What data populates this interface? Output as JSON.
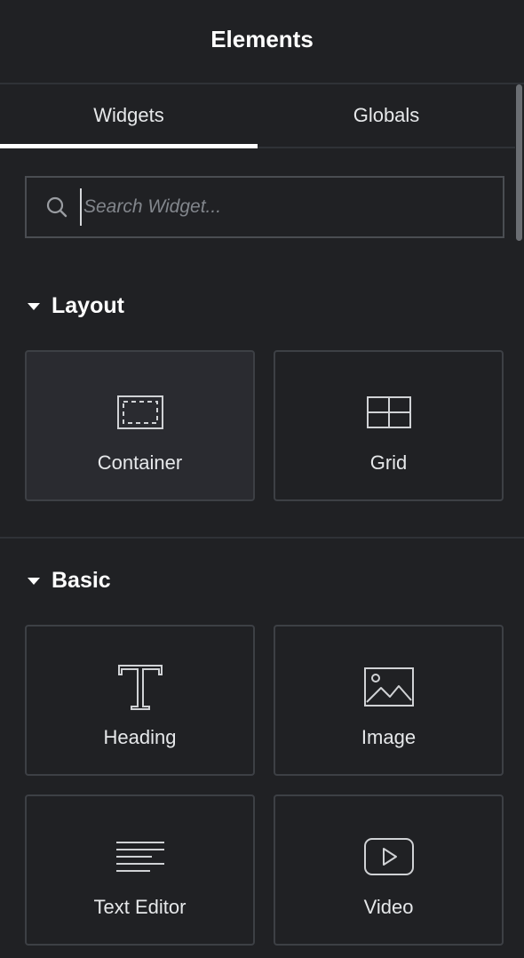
{
  "header": {
    "title": "Elements"
  },
  "tabs": [
    {
      "label": "Widgets",
      "active": true
    },
    {
      "label": "Globals",
      "active": false
    }
  ],
  "search": {
    "placeholder": "Search Widget...",
    "value": ""
  },
  "sections": [
    {
      "title": "Layout",
      "widgets": [
        {
          "label": "Container",
          "icon": "container-icon"
        },
        {
          "label": "Grid",
          "icon": "grid-icon"
        }
      ]
    },
    {
      "title": "Basic",
      "widgets": [
        {
          "label": "Heading",
          "icon": "heading-icon"
        },
        {
          "label": "Image",
          "icon": "image-icon"
        },
        {
          "label": "Text Editor",
          "icon": "text-editor-icon"
        },
        {
          "label": "Video",
          "icon": "video-icon"
        }
      ]
    }
  ],
  "colors": {
    "background": "#202124",
    "card_border": "#3d4045",
    "card_hover": "#2a2b30",
    "text": "#e6e8ea",
    "tab_indicator": "#ffffff"
  }
}
